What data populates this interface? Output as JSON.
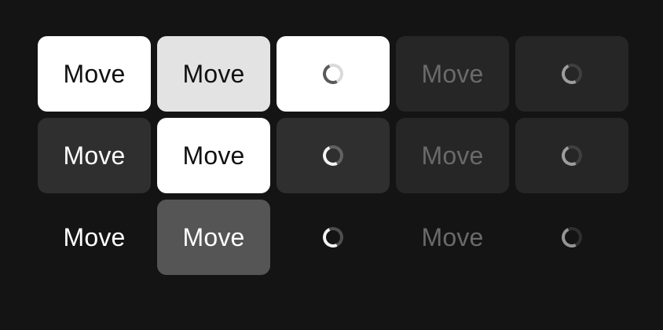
{
  "buttons": {
    "label": "Move"
  },
  "icons": {
    "loading": "loading-spinner-icon"
  },
  "colors": {
    "page_background": "#141414",
    "white": "#ffffff",
    "light_gray": "#e3e3e3",
    "dark_gray": "#2f2f2f",
    "darker_gray": "#262626",
    "mid_gray": "#555555",
    "dim_text": "#6a6a6a"
  }
}
